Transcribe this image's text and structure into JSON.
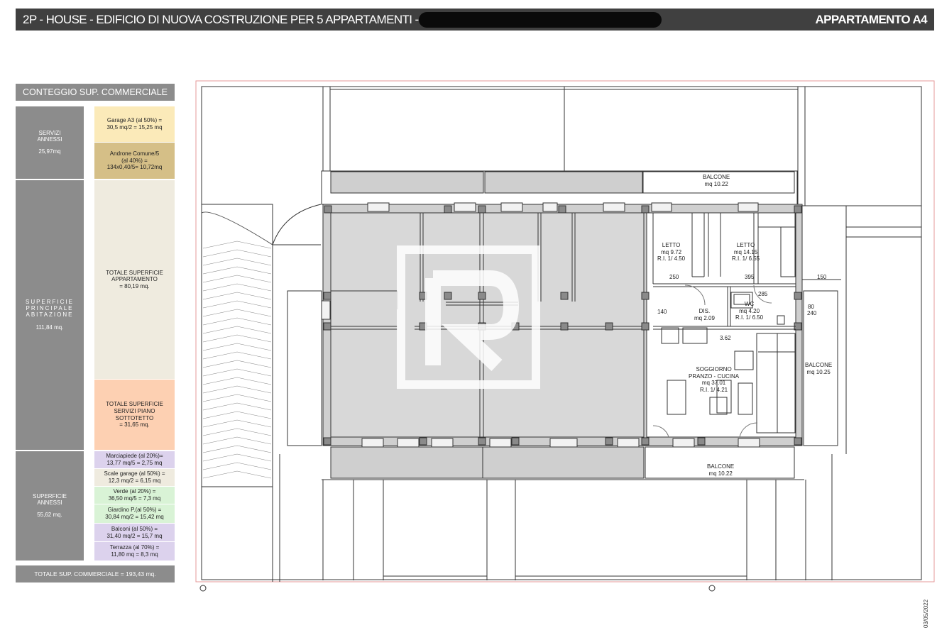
{
  "header": {
    "title": "2P - HOUSE  - EDIFICIO DI NUOVA COSTRUZIONE PER 5 APPARTAMENTI -",
    "apartment": "APPARTAMENTO A4"
  },
  "panel": {
    "title": "CONTEGGIO SUP. COMMERCIALE",
    "groups": [
      {
        "title": "SERVIZI\nANNESSI",
        "value": "25,97mq"
      },
      {
        "title": "SUPERFICIE\nPRINCIPALE\nABITAZIONE",
        "value": "111,84 mq."
      },
      {
        "title": "SUPERFICIE\nANNESSI",
        "value": "55,62 mq."
      }
    ],
    "items": [
      {
        "text": "Garage A3   (al 50%) =\n30,5 mq/2 = 15,25 mq",
        "color": "#fbeab9"
      },
      {
        "text": "Androne Comune/5\n(al 40%) =\n134x0,40/5= 10,72mq",
        "color": "#d5bf87"
      },
      {
        "text": "TOTALE SUPERFICIE\nAPPARTAMENTO\n= 80,19 mq.",
        "color": "#efebdf"
      },
      {
        "text": "TOTALE SUPERFICIE\nSERVIZI PIANO\nSOTTOTETTO\n= 31,65 mq.",
        "color": "#fdd0b2"
      },
      {
        "text": "Marciapiede (al 20%)=\n13,77 mq/5 = 2,75 mq",
        "color": "#dcd2ed"
      },
      {
        "text": "Scale garage (al 50%) =\n12,3 mq/2 = 6,15 mq",
        "color": "#efebdf"
      },
      {
        "text": "Verde (al 20%) =\n36,50 mq/5 = 7,3 mq",
        "color": "#d9f3d6"
      },
      {
        "text": "Giardino P.(al 50%) =\n30,84 mq/2 = 15,42 mq",
        "color": "#d9f3d6"
      },
      {
        "text": "Balconi (al 50%) =\n31,40 mq/2 = 15,7 mq",
        "color": "#dcd2ed"
      },
      {
        "text": "Terrazza (al 70%) =\n11,80 mq = 8,3 mq",
        "color": "#dcd2ed"
      }
    ],
    "total": "TOTALE SUP. COMMERCIALE = 193,43 mq."
  },
  "plan": {
    "rooms": {
      "balcone_top": "BALCONE\nmq 10.22",
      "letto1": "LETTO\nmq 9.72\nR.I. 1/ 4.50",
      "letto2": "LETTO\nmq 14.15\nR.I. 1/ 6.55",
      "dis": "DIS.\nmq 2.09",
      "wc": "WC\nmq 4.20\nR.I. 1/ 6.50",
      "soggiorno": "SOGGIORNO\nPRANZO - CUCINA\nmq 37.01\nR.I. 1/ 4.21",
      "balcone_right": "BALCONE\nmq 10.25",
      "balcone_bottom": "BALCONE\nmq 10.22"
    },
    "dims": {
      "d250": "250",
      "d395": "395",
      "d150": "150",
      "d140": "140",
      "d362": "3.62",
      "d285": "285",
      "d80": "80",
      "d240": "240"
    }
  },
  "date": "03/05/2022",
  "colors": {
    "header_bg": "#404040",
    "panel_gray": "#8c8c8c",
    "wall_gray": "#cfcfcf"
  }
}
